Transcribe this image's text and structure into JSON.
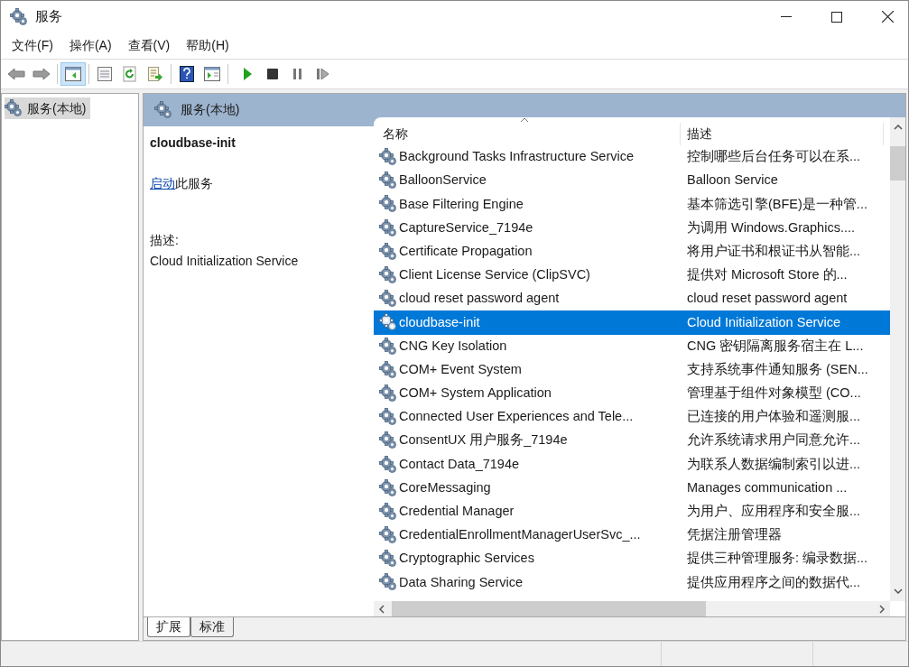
{
  "window": {
    "title": "服务"
  },
  "menu": [
    "文件(F)",
    "操作(A)",
    "查看(V)",
    "帮助(H)"
  ],
  "toolbar": {
    "tree_toggle_on": true
  },
  "tree": [
    {
      "label": "服务(本地)",
      "selected": true
    }
  ],
  "pane": {
    "header": "服务(本地)",
    "service_name": "cloudbase-init",
    "action_link": "启动",
    "action_text": "此服务",
    "description_label": "描述:",
    "description": "Cloud Initialization Service"
  },
  "table": {
    "columns": [
      "名称",
      "描述"
    ],
    "rows": [
      {
        "name": "Background Tasks Infrastructure Service",
        "description": "控制哪些后台任务可以在系...",
        "selected": false
      },
      {
        "name": "BalloonService",
        "description": "Balloon Service",
        "selected": false
      },
      {
        "name": "Base Filtering Engine",
        "description": "基本筛选引擎(BFE)是一种管...",
        "selected": false
      },
      {
        "name": "CaptureService_7194e",
        "description": "为调用 Windows.Graphics....",
        "selected": false
      },
      {
        "name": "Certificate Propagation",
        "description": "将用户证书和根证书从智能...",
        "selected": false
      },
      {
        "name": "Client License Service (ClipSVC)",
        "description": "提供对 Microsoft Store 的...",
        "selected": false
      },
      {
        "name": "cloud reset password agent",
        "description": "cloud reset password agent",
        "selected": false
      },
      {
        "name": "cloudbase-init",
        "description": "Cloud Initialization Service",
        "selected": true
      },
      {
        "name": "CNG Key Isolation",
        "description": "CNG 密钥隔离服务宿主在 L...",
        "selected": false
      },
      {
        "name": "COM+ Event System",
        "description": "支持系统事件通知服务 (SEN...",
        "selected": false
      },
      {
        "name": "COM+ System Application",
        "description": "管理基于组件对象模型 (CO...",
        "selected": false
      },
      {
        "name": "Connected User Experiences and Tele...",
        "description": "已连接的用户体验和遥测服...",
        "selected": false
      },
      {
        "name": "ConsentUX 用户服务_7194e",
        "description": "允许系统请求用户同意允许...",
        "selected": false
      },
      {
        "name": "Contact Data_7194e",
        "description": "为联系人数据编制索引以进...",
        "selected": false
      },
      {
        "name": "CoreMessaging",
        "description": "Manages communication ...",
        "selected": false
      },
      {
        "name": "Credential Manager",
        "description": "为用户、应用程序和安全服...",
        "selected": false
      },
      {
        "name": "CredentialEnrollmentManagerUserSvc_...",
        "description": "凭据注册管理器",
        "selected": false
      },
      {
        "name": "Cryptographic Services",
        "description": "提供三种管理服务: 编录数据...",
        "selected": false
      },
      {
        "name": "Data Sharing Service",
        "description": "提供应用程序之间的数据代...",
        "selected": false
      }
    ]
  },
  "tabs": [
    {
      "label": "扩展",
      "selected": true
    },
    {
      "label": "标准",
      "selected": false
    }
  ]
}
